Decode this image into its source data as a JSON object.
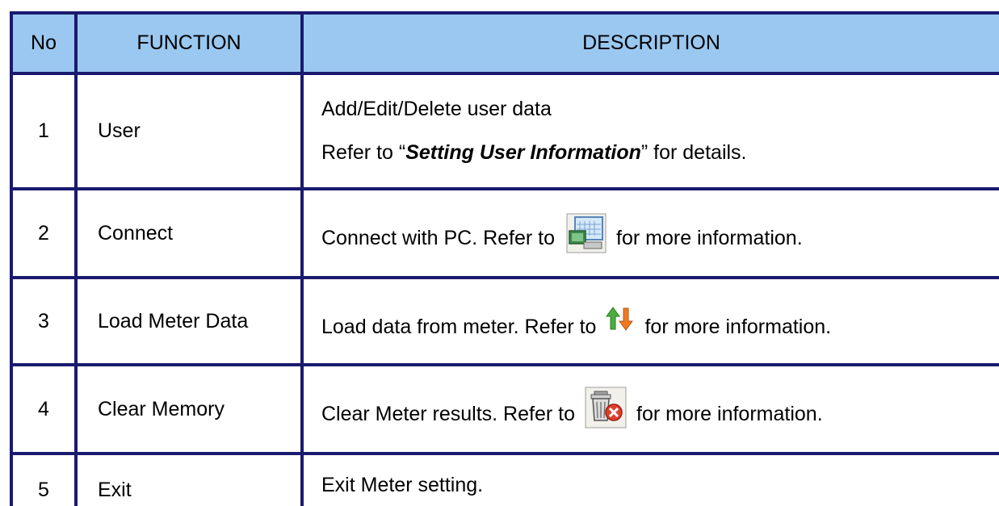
{
  "header": {
    "no": "No",
    "function": "FUNCTION",
    "description": "DESCRIPTION"
  },
  "rows": [
    {
      "no": "1",
      "function": "User",
      "desc_line1": "Add/Edit/Delete user data",
      "desc_line2_pre": "Refer to “",
      "desc_line2_em": "Setting User Information",
      "desc_line2_post": "” for details."
    },
    {
      "no": "2",
      "function": "Connect",
      "desc_pre": "Connect with PC. Refer to",
      "desc_icon": "connect-pc-icon",
      "desc_post": "for more information."
    },
    {
      "no": "3",
      "function": "Load Meter Data",
      "desc_pre": "Load data from meter. Refer to",
      "desc_icon": "up-down-arrows-icon",
      "desc_post": "for more information."
    },
    {
      "no": "4",
      "function": "Clear Memory",
      "desc_pre": "Clear Meter results. Refer to",
      "desc_icon": "trash-delete-icon",
      "desc_post": "for more information."
    },
    {
      "no": "5",
      "function": "Exit",
      "desc": "Exit Meter setting."
    }
  ],
  "colors": {
    "header_bg": "#9ac8f0",
    "border": "#1a1a6e"
  }
}
